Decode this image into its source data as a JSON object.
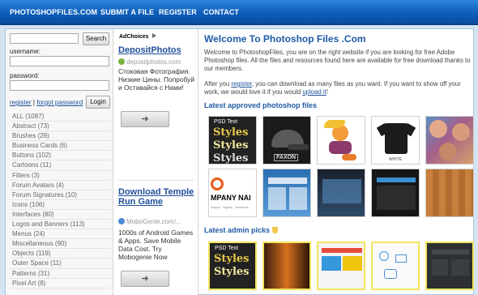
{
  "nav": {
    "site": "PHOTOSHOPFILES.COM",
    "submit": "SUBMIT A FILE",
    "register": "REGISTER",
    "contact": "CONTACT"
  },
  "sidebar": {
    "search_button": "Search",
    "username_label": "username:",
    "password_label": "password:",
    "register_link": "register",
    "separator": "|",
    "forgot_link": "forgot password",
    "login_button": "Login",
    "categories": [
      "ALL (1087)",
      "Abstract (73)",
      "Brushes (29)",
      "Business Cards (6)",
      "Buttons (102)",
      "Cartoons (11)",
      "Filters (3)",
      "Forum Avatars (4)",
      "Forum Signatures (10)",
      "Icons (106)",
      "Interfaces (80)",
      "Logos and Banners (113)",
      "Menus (24)",
      "Miscellaneous (90)",
      "Objects (119)",
      "Outer Space (11)",
      "Patterns (31)",
      "Pixel Art (8)"
    ]
  },
  "ads": {
    "adchoices": "AdChoices",
    "ad1": {
      "title": "DepositPhotos",
      "url": "depositphotos.com",
      "text": "Стоковая Фотография. Низкие Цены. Попробуй и Оставайся с Нами!"
    },
    "ad2": {
      "title": "Download Temple Run Game",
      "url": "MoboGenie.com/...",
      "text": "1000s of Android Games & Apps. Save Mobile Data Cost. Try Mobogenie Now"
    },
    "arrow": "➜"
  },
  "main": {
    "title": "Welcome To Photoshop Files .Com",
    "intro": "Welcome to PhotoshopFiles, you are on the right website if you are looking for free Adobe Photoshop files. All the files and resources found here are available for free download thanks to our members.",
    "after_pre": "After you ",
    "after_link": "register",
    "after_mid": ", you can download as many files as you want. If you want to show off your work, we would love it if you would ",
    "after_link2": "upload it",
    "after_end": "!",
    "latest_heading": "Latest approved photoshop files",
    "admin_heading": "Latest admin picks",
    "psd_line1": "PSD Text",
    "psd_word": "Styles",
    "faxon": "FAXON",
    "white": "WHITE",
    "company": "MPANY NAI",
    "company_sub": "slogan · tagline · business"
  },
  "colors": {
    "nav_blue": "#0b5bb8",
    "heading_blue": "#1f5aa6",
    "link_blue": "#1f4f9a",
    "admin_highlight": "#f2e55e"
  }
}
